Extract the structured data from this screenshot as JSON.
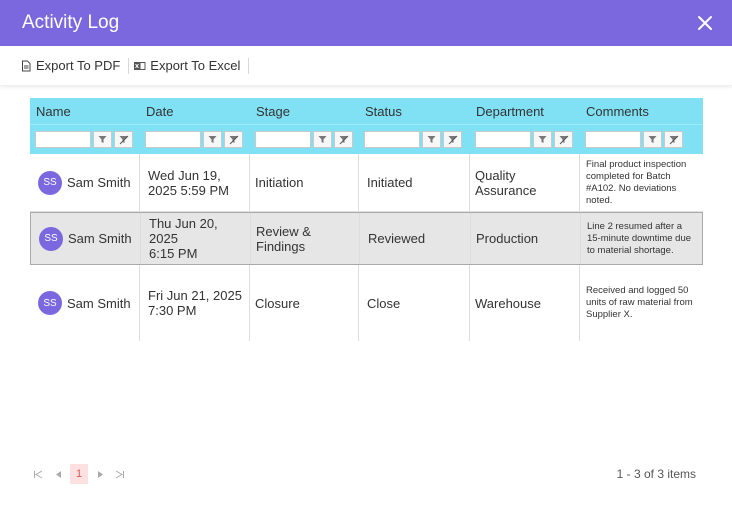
{
  "title": "Activity Log",
  "toolbar": {
    "export_pdf": "Export To PDF",
    "export_excel": "Export To Excel"
  },
  "columns": [
    "Name",
    "Date",
    "Stage",
    "Status",
    "Department",
    "Comments"
  ],
  "rows": [
    {
      "initials": "SS",
      "name": "Sam Smith",
      "date_line1": "Wed Jun 19,",
      "date_line2": "2025 5:59 PM",
      "stage": "Initiation",
      "status": "Initiated",
      "department": "Quality Assurance",
      "comment": "Final product inspection completed for Batch #A102. No deviations noted."
    },
    {
      "initials": "SS",
      "name": "Sam Smith",
      "date_line1": "Thu Jun 20, 2025",
      "date_line2": "6:15 PM",
      "stage": "Review & Findings",
      "status": "Reviewed",
      "department": "Production",
      "comment": "Line 2 resumed after a 15-minute downtime due to material shortage."
    },
    {
      "initials": "SS",
      "name": "Sam Smith",
      "date_line1": "Fri Jun 21, 2025",
      "date_line2": "7:30 PM",
      "stage": "Closure",
      "status": "Close",
      "department": "Warehouse",
      "comment": "Received and logged 50 units of raw material from Supplier X."
    }
  ],
  "pager": {
    "current_page": "1",
    "info": "1 - 3 of 3 items"
  },
  "colors": {
    "header_bar": "#7b68de",
    "grid_header": "#80e0f4",
    "avatar": "#7b68de",
    "selected_row": "#e6e6e6",
    "active_page": "#fde0e0"
  }
}
